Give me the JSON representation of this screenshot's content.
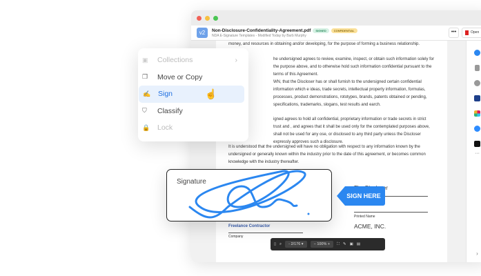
{
  "window": {
    "file_name": "Non-Disclosure-Confidentiality-Agreement.pdf",
    "version": "v2",
    "badges": {
      "signed": "SIGNED",
      "confidential": "CONFIDENTIAL"
    },
    "subtitle": "NDA E-Signature Templates - Modified Today by Barb Murphy",
    "more_label": "•••",
    "open_label": "Open"
  },
  "document": {
    "paragraphs": [
      "money, and resources in obtaining and/or developing, for the purpose of forming a business relationship.",
      "he undersigned agrees to review, examine, inspect, or obtain such information solely for the purpose above, and to otherwise hold such information confidential pursuant to the terms of this Agreement.",
      "WN, that the Discloser has or shall furnish to the undersigned certain confidential information which e ideas, trade secrets, intellectual property information, formulas, processes, product demonstrations, rototypes, brands, patents obtained or pending, specifications, trademarks, slogans, test results and earch.",
      "igned agrees to hold all confidential, proprietary information or trade secrets in strict trust and , and agrees that it shall be used only for the contemplated purposes above, shall not be used for any ose, or disclosed to any third party unless the Discloser expressly approves such a disclosure.",
      "It is understood that the undersigned will have no obligation with respect to any information known by the undersigned or generally known within the industry prior to the date of this agreement, or becomes common knowledge with the industry thereafter."
    ],
    "discloser": "The Discloser",
    "printed_name": "Printed Name",
    "company_name": "ACME, INC.",
    "contractor": "Freelance Contractor",
    "company_label": "Company"
  },
  "menu": {
    "items": [
      {
        "label": "Collections"
      },
      {
        "label": "Move or Copy"
      },
      {
        "label": "Sign"
      },
      {
        "label": "Classify"
      },
      {
        "label": "Lock"
      }
    ]
  },
  "signature": {
    "label": "Signature",
    "sign_here": "SIGN HERE",
    "color": "#2b87f0"
  },
  "toolbar": {
    "page": "2/176",
    "zoom": "100%"
  }
}
